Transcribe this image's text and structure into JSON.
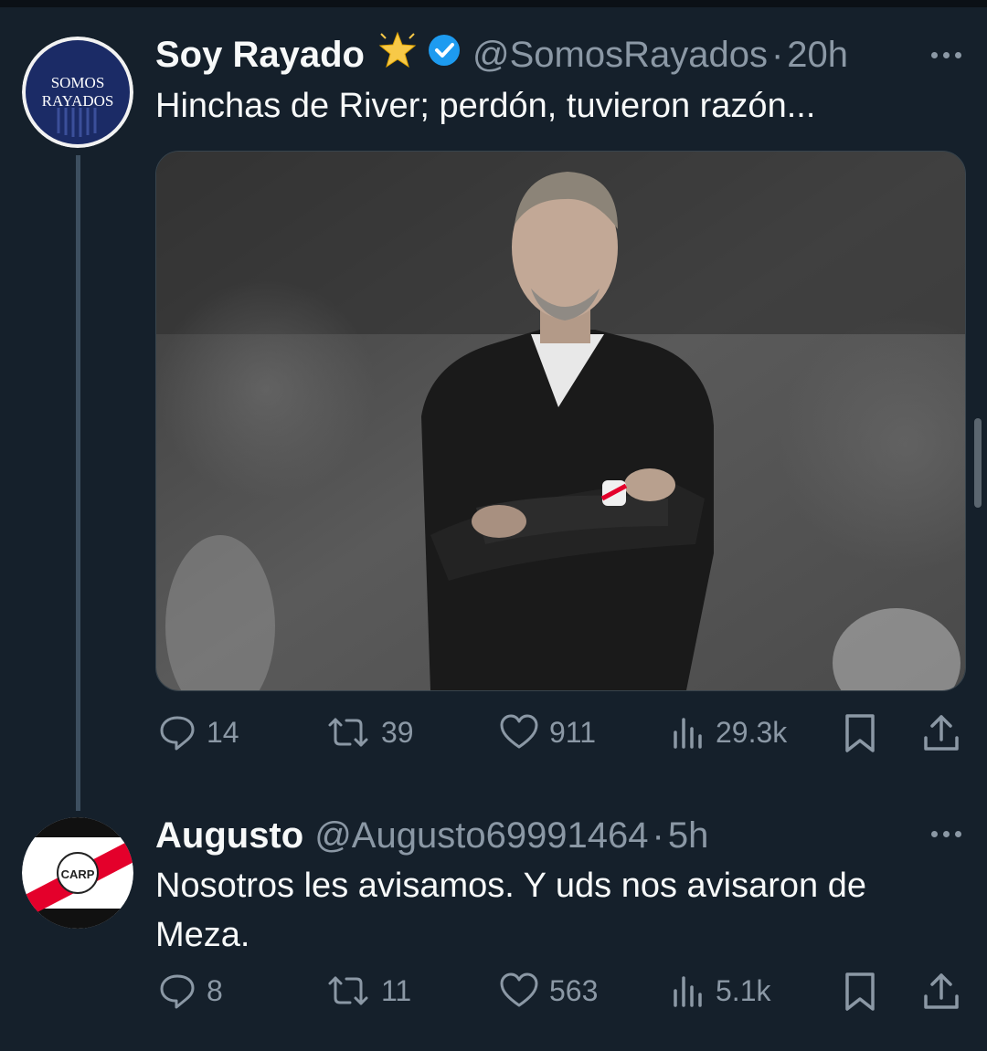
{
  "tweet1": {
    "name": "Soy Rayado",
    "handle": "@SomosRayados",
    "separator": "·",
    "time": "20h",
    "text": "Hinchas de River; perdón, tuvieron razón...",
    "avatar_text": [
      "SOMOS",
      "RAYADOS"
    ],
    "stats": {
      "replies": "14",
      "retweets": "39",
      "likes": "911",
      "views": "29.3k"
    }
  },
  "tweet2": {
    "name": "Augusto",
    "handle": "@Augusto69991464",
    "separator": "·",
    "time": "5h",
    "text": "Nosotros les avisamos. Y uds nos avisaron de Meza.",
    "avatar_text": "CARP",
    "stats": {
      "replies": "8",
      "retweets": "11",
      "likes": "563",
      "views": "5.1k"
    }
  },
  "colors": {
    "background": "#15202b",
    "verified": "#1d9bf0",
    "muted": "#8b98a5",
    "river_red": "#e4002b"
  },
  "icons": [
    "star-badge-icon",
    "verified-icon",
    "more-icon",
    "reply-icon",
    "retweet-icon",
    "like-icon",
    "views-icon",
    "bookmark-icon",
    "share-icon"
  ]
}
